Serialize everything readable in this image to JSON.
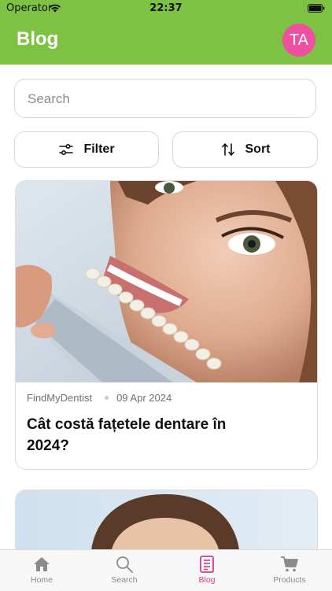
{
  "status_bar": {
    "carrier": "Operator",
    "time": "22:37"
  },
  "app_bar": {
    "title": "Blog",
    "avatar_initials": "TA",
    "accent": "#7dc243",
    "avatar_color": "#ee4fa1"
  },
  "search": {
    "placeholder": "Search",
    "value": ""
  },
  "controls": {
    "filter_label": "Filter",
    "sort_label": "Sort"
  },
  "posts": [
    {
      "source": "FindMyDentist",
      "date": "09 Apr 2024",
      "title": "Cât costă fațetele dentare în 2024?",
      "image_icon": "dental-shade-guide-photo"
    },
    {
      "image_icon": "woman-portrait-photo"
    }
  ],
  "tabbar": {
    "active_color": "#d23d94",
    "items": [
      {
        "label": "Home",
        "icon": "home-icon"
      },
      {
        "label": "Search",
        "icon": "search-icon"
      },
      {
        "label": "Blog",
        "icon": "blog-icon",
        "active": true
      },
      {
        "label": "Products",
        "icon": "cart-icon"
      }
    ]
  }
}
